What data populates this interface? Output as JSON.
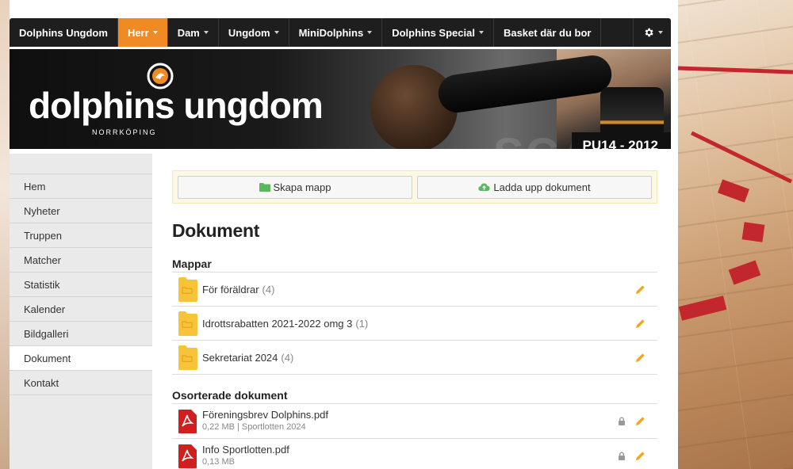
{
  "nav": {
    "items": [
      {
        "label": "Dolphins Ungdom",
        "caret": false,
        "active": false
      },
      {
        "label": "Herr",
        "caret": true,
        "active": true
      },
      {
        "label": "Dam",
        "caret": true,
        "active": false
      },
      {
        "label": "Ungdom",
        "caret": true,
        "active": false
      },
      {
        "label": "MiniDolphins",
        "caret": true,
        "active": false
      },
      {
        "label": "Dolphins Special",
        "caret": true,
        "active": false
      },
      {
        "label": "Basket där du bor",
        "caret": false,
        "active": false
      }
    ],
    "settings_icon": "gear-icon"
  },
  "banner": {
    "logo_text": "dolphins ungdom",
    "logo_subtitle": "NORRKÖPING",
    "team_tag": "PU14 - 2012"
  },
  "sidebar": {
    "items": [
      {
        "label": "Hem"
      },
      {
        "label": "Nyheter"
      },
      {
        "label": "Truppen"
      },
      {
        "label": "Matcher"
      },
      {
        "label": "Statistik"
      },
      {
        "label": "Kalender"
      },
      {
        "label": "Bildgalleri"
      },
      {
        "label": "Dokument",
        "active": true
      },
      {
        "label": "Kontakt"
      }
    ]
  },
  "toolbar": {
    "create_folder_label": "Skapa mapp",
    "upload_label": "Ladda upp dokument"
  },
  "main": {
    "title": "Dokument",
    "folders_title": "Mappar",
    "folders": [
      {
        "name": "För föräldrar",
        "count": "(4)"
      },
      {
        "name": "Idrottsrabatten 2021-2022 omg 3",
        "count": "(1)"
      },
      {
        "name": "Sekretariat 2024",
        "count": "(4)"
      }
    ],
    "docs_title": "Osorterade dokument",
    "documents": [
      {
        "name": "Föreningsbrev Dolphins.pdf",
        "meta": "0,22 MB | Sportlotten 2024"
      },
      {
        "name": "Info Sportlotten.pdf",
        "meta": "0,13 MB"
      }
    ]
  },
  "colors": {
    "nav_bg": "#1e1e1e",
    "nav_active": "#f08a24",
    "folder_yellow": "#f7c33a",
    "pdf_red": "#d11f1f",
    "pencil": "#f0a818",
    "toolbar_bg": "#fcf8e3"
  }
}
